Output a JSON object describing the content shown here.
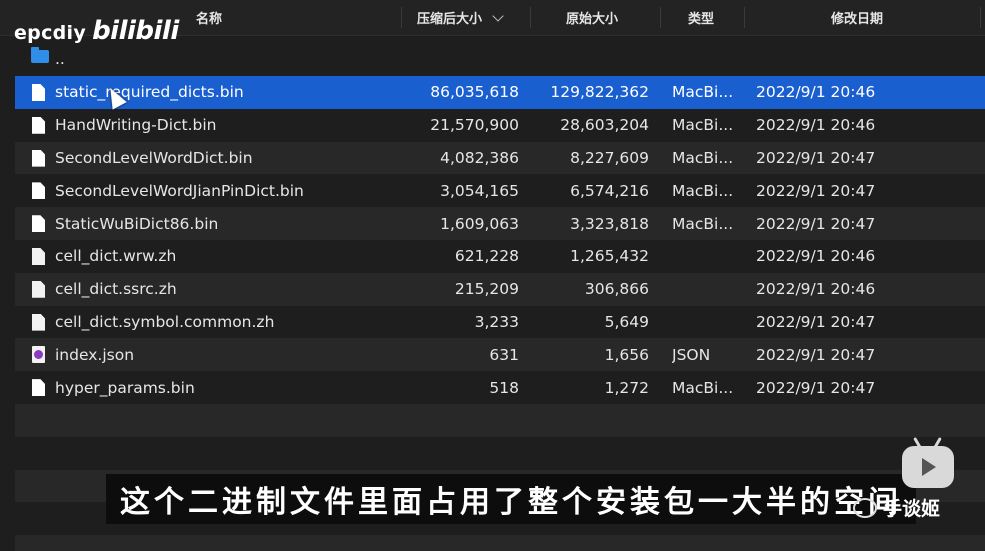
{
  "header": {
    "name": "名称",
    "compressed_size": "压缩后大小",
    "original_size": "原始大小",
    "type": "类型",
    "modified": "修改日期"
  },
  "watermark": {
    "channel": "epcdiy",
    "brand": "bilibili"
  },
  "parent_row": {
    "name": ".."
  },
  "files": [
    {
      "name": "static_required_dicts.bin",
      "compressed": "86,035,618",
      "original": "129,822,362",
      "type": "MacBi...",
      "date": "2022/9/1 20:46",
      "icon": "document-icon",
      "selected": true
    },
    {
      "name": "HandWriting-Dict.bin",
      "compressed": "21,570,900",
      "original": "28,603,204",
      "type": "MacBi...",
      "date": "2022/9/1 20:46",
      "icon": "document-icon"
    },
    {
      "name": "SecondLevelWordDict.bin",
      "compressed": "4,082,386",
      "original": "8,227,609",
      "type": "MacBi...",
      "date": "2022/9/1 20:47",
      "icon": "document-icon"
    },
    {
      "name": "SecondLevelWordJianPinDict.bin",
      "compressed": "3,054,165",
      "original": "6,574,216",
      "type": "MacBi...",
      "date": "2022/9/1 20:47",
      "icon": "document-icon"
    },
    {
      "name": "StaticWuBiDict86.bin",
      "compressed": "1,609,063",
      "original": "3,323,818",
      "type": "MacBi...",
      "date": "2022/9/1 20:47",
      "icon": "document-icon"
    },
    {
      "name": "cell_dict.wrw.zh",
      "compressed": "621,228",
      "original": "1,265,432",
      "type": "",
      "date": "2022/9/1 20:46",
      "icon": "blank-document-icon"
    },
    {
      "name": "cell_dict.ssrc.zh",
      "compressed": "215,209",
      "original": "306,866",
      "type": "",
      "date": "2022/9/1 20:46",
      "icon": "blank-document-icon"
    },
    {
      "name": "cell_dict.symbol.common.zh",
      "compressed": "3,233",
      "original": "5,649",
      "type": "",
      "date": "2022/9/1 20:47",
      "icon": "blank-document-icon"
    },
    {
      "name": "index.json",
      "compressed": "631",
      "original": "1,656",
      "type": "JSON",
      "date": "2022/9/1 20:47",
      "icon": "json-file-icon"
    },
    {
      "name": "hyper_params.bin",
      "compressed": "518",
      "original": "1,272",
      "type": "MacBi...",
      "date": "2022/9/1 20:47",
      "icon": "document-icon"
    }
  ],
  "subtitle": "这个二进制文件里面占用了整个安装包一大半的空间",
  "wechat_account": "手谈姬",
  "colors": {
    "selection": "#1a5fd0",
    "background": "#1e1e1e",
    "stripe": "#282828",
    "folder": "#2f8fe8"
  }
}
